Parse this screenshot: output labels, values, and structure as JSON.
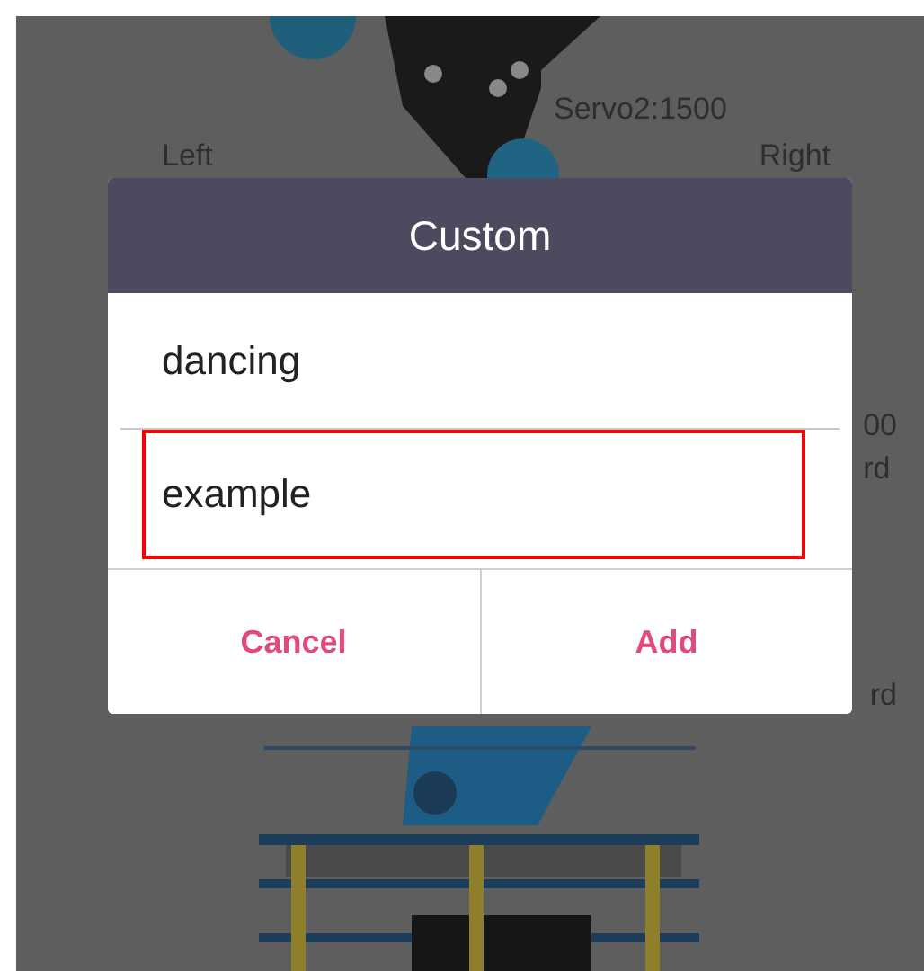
{
  "screen": {
    "servo_reading": "Servo2:1500",
    "left_label": "Left",
    "right_label": "Right",
    "partial_rows": [
      {
        "reading": "00",
        "right": "rd"
      },
      {
        "right": "rd"
      }
    ]
  },
  "dialog": {
    "title": "Custom",
    "items": [
      {
        "label": "dancing",
        "selected": false
      },
      {
        "label": "example",
        "selected": true
      }
    ],
    "buttons": [
      "Cancel",
      "Add"
    ]
  }
}
